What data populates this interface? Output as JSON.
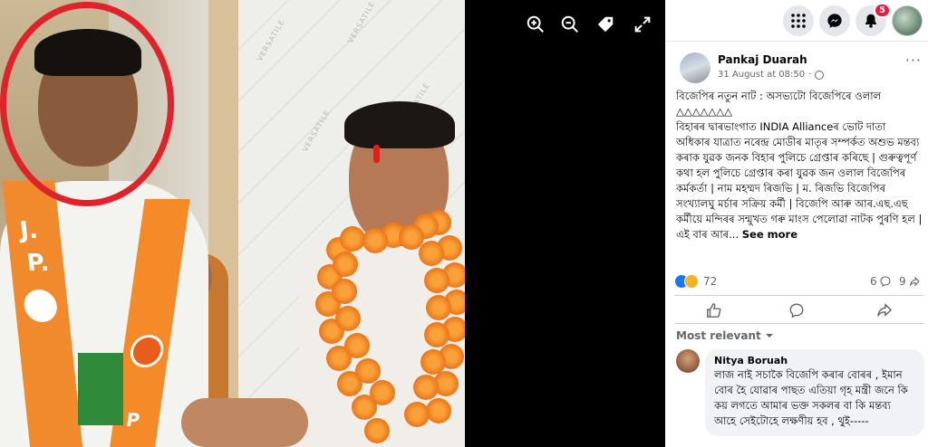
{
  "viewer": {
    "tools": [
      {
        "icon": "zoom-in-icon"
      },
      {
        "icon": "zoom-out-icon"
      },
      {
        "icon": "tag-icon"
      },
      {
        "icon": "fullscreen-icon"
      }
    ],
    "photo": {
      "stole_letters": [
        "J.",
        "P.",
        "P"
      ],
      "wall_word": "VERSATILE"
    }
  },
  "topbar": {
    "notifications_count": "5",
    "icons": [
      "menu-grid-icon",
      "messenger-icon",
      "notifications-bell-icon",
      "profile-avatar"
    ]
  },
  "post": {
    "author": "Pankaj Duarah",
    "time": "31 August at 08:50",
    "time_separator": "·",
    "more": "···",
    "text": [
      "বিজেপিৰ নতুন নাট : অসভ্যটো বিজেপিৰে ওলাল",
      "△△△△△△△",
      "বিহাৰৰ দ্বাৰভাংগাত INDIA Allianceৰ ভোট দাতা অধিকাৰ যাত্ৰাত নৰেন্দ্ৰ মোডীৰ মাতৃৰ সম্পৰ্কত অশুভ মন্তব্য কৰাক যুৱক জনক বিহাৰ পুলিচে গ্ৰেপ্তাৰ কৰিছে | গুৰুত্বপূৰ্ণ কথা হল পুলিচে গ্ৰেপ্তাৰ কৰা যুৱক জন ওলাল বিজেপিৰ কৰ্মকৰ্তা | নাম মহম্মদ ৰিজভি | ম. ৰিজভি বিজেপিৰ সংখ্যালঘু মৰ্চাৰ সক্ৰিয় কৰ্মী | বিজেপি আৰু আৰ.এছ.এছ কৰ্মীয়ে মন্দিৰৰ সন্মুখত গৰু মাংস পেলোৱা নাটক পুৰণি হল | এই বাৰ আৰ... "
    ],
    "see_more": "See more",
    "reaction_count": "72",
    "comment_count": "6",
    "share_count": "9"
  },
  "actions": {
    "like_icon": "like-icon",
    "comment_icon": "comment-icon",
    "share_icon": "share-icon"
  },
  "comments": {
    "sort_label": "Most relevant",
    "items": [
      {
        "author": "Nitya Boruah",
        "text": "লাজ নাই সচাকৈ বিজেপি কৰাৰ বোৰৰ , ইমান বোৰ হৈ যোৱাৰ পাছত এতিয়া গৃহ মন্ত্ৰী জনে কি কয় লগতে আমাৰ ভক্ত সকলৰ বা কি মন্তব্য আহে সেইটোহে লক্ষণীয় হব , থুই-----"
      }
    ]
  },
  "colors": {
    "accent": "#1877f2",
    "badge": "#e41e3f",
    "circle": "#e0232b"
  }
}
